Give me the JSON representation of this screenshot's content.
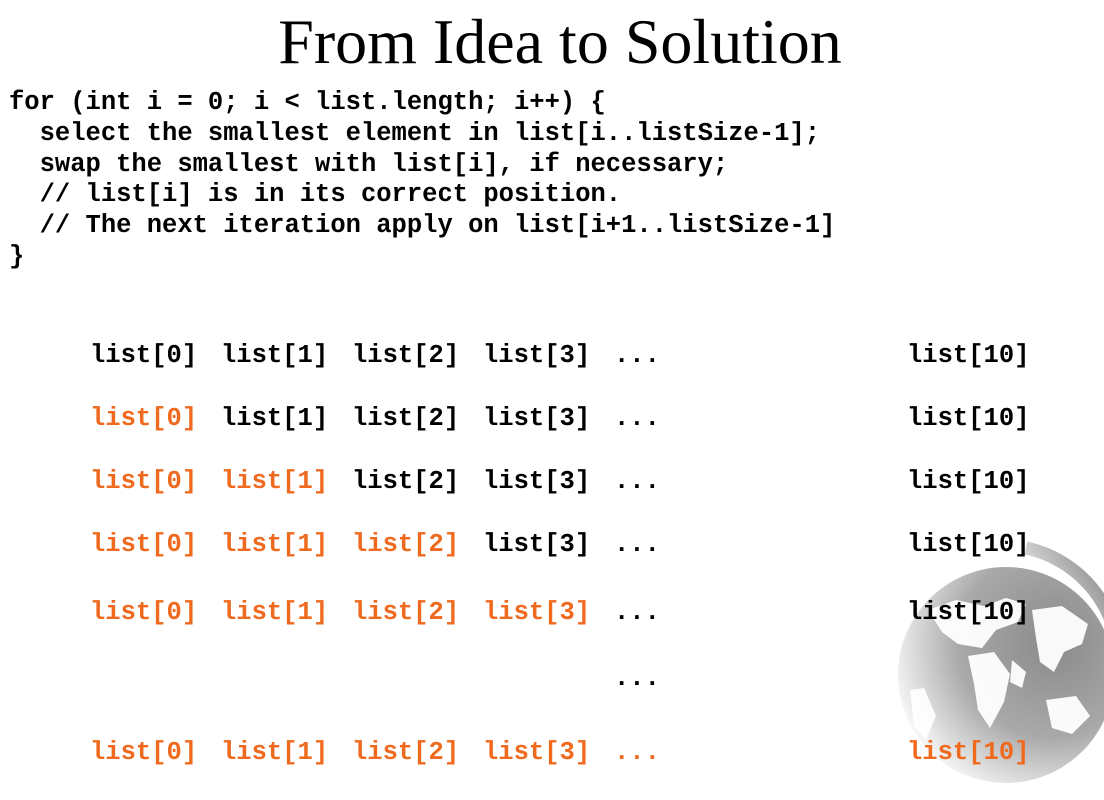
{
  "slide": {
    "title": "From Idea to Solution"
  },
  "code": {
    "lines": [
      "for (int i = 0; i < list.length; i++) {",
      "  select the smallest element in list[i..listSize-1];",
      "  swap the smallest with list[i], if necessary;",
      "  // list[i] is in its correct position.",
      "  // The next iteration apply on list[i+1..listSize-1]",
      "}"
    ]
  },
  "colors": {
    "sorted": "#ef6a1e",
    "unsorted": "#000000"
  },
  "array": {
    "labels": [
      "list[0]",
      "list[1]",
      "list[2]",
      "list[3]",
      "...",
      "list[10]"
    ],
    "rows": [
      {
        "sorted_count": 0,
        "last_sorted": false
      },
      {
        "sorted_count": 1,
        "last_sorted": false
      },
      {
        "sorted_count": 2,
        "last_sorted": false
      },
      {
        "sorted_count": 3,
        "last_sorted": false
      },
      {
        "sorted_count": 4,
        "last_sorted": false
      },
      {
        "sorted_count": 5,
        "last_sorted": true
      }
    ],
    "ellipsis": "..."
  },
  "decoration": {
    "icon": "globe-icon"
  }
}
